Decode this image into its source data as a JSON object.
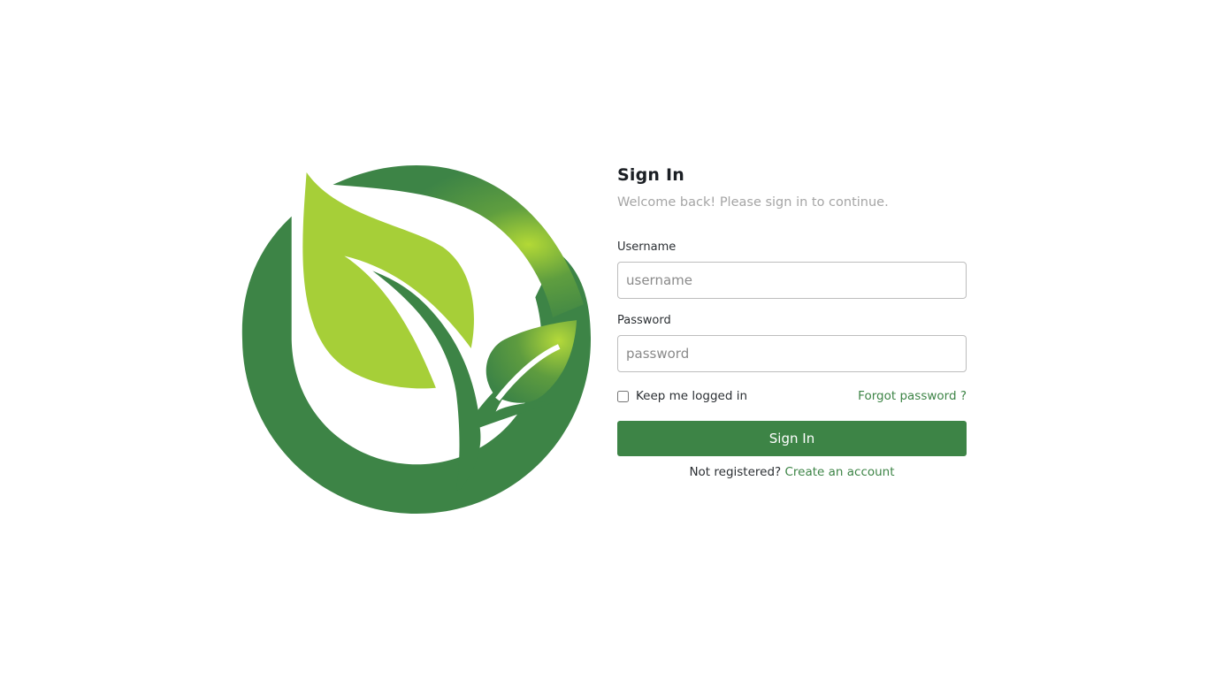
{
  "logo": {
    "name": "plant-leaf-logo",
    "colors": {
      "ring": "#3d8446",
      "leaf_light": "#a6cf38",
      "leaf_glow": "#9ccb35"
    }
  },
  "form": {
    "title": "Sign In",
    "subtitle": "Welcome back! Please sign in to continue.",
    "username": {
      "label": "Username",
      "value": "",
      "placeholder": "username"
    },
    "password": {
      "label": "Password",
      "value": "",
      "placeholder": "password"
    },
    "remember": {
      "label": "Keep me logged in",
      "checked": false
    },
    "forgot_label": "Forgot password ?",
    "submit_label": "Sign In",
    "register_prompt": "Not registered?",
    "register_link": "Create an account"
  },
  "colors": {
    "accent": "#3d8446",
    "muted_text": "#a5a5a5",
    "text": "#2b2f33"
  }
}
